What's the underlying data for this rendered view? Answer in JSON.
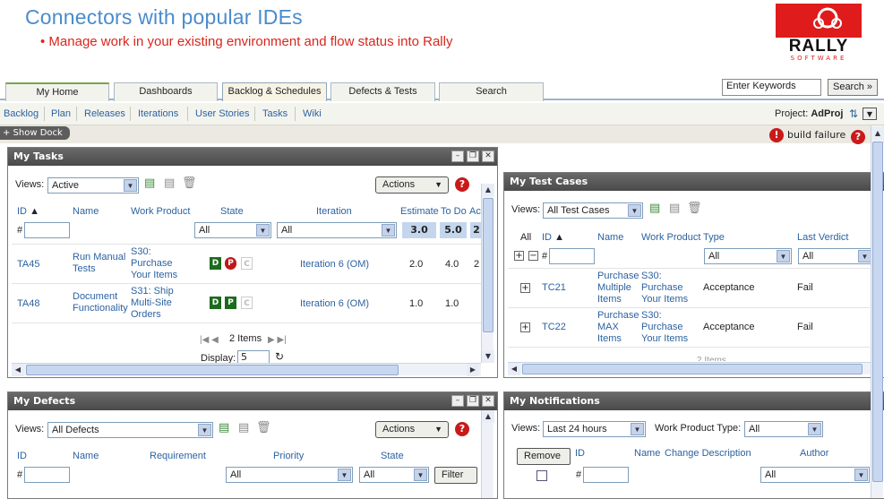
{
  "header": {
    "title": "Connectors with popular IDEs",
    "subtitle": "• Manage work in your existing environment and flow status into Rally",
    "logo_word": "RALLY",
    "logo_sub": "SOFTWARE"
  },
  "tabs": [
    "My Home",
    "Dashboards",
    "Backlog & Schedules",
    "Defects & Tests",
    "Search"
  ],
  "search": {
    "value": "Enter Keywords",
    "button": "Search »"
  },
  "subnav": [
    "Backlog",
    "Plan",
    "Releases",
    "Iterations",
    "User Stories",
    "Tasks",
    "Wiki"
  ],
  "project": {
    "label": "Project:",
    "name": "AdProj"
  },
  "dock": {
    "show": "+ Show Dock",
    "alert": "build failure"
  },
  "tasks": {
    "title": "My Tasks",
    "views_label": "Views:",
    "view": "Active",
    "actions": "Actions",
    "columns": [
      "ID",
      "Name",
      "Work Product",
      "State",
      "Iteration",
      "Estimate",
      "To Do",
      "Ac"
    ],
    "filter_state": "All",
    "filter_iteration": "All",
    "totals": {
      "estimate": "3.0",
      "todo": "5.0",
      "actual": "2"
    },
    "rows": [
      {
        "id": "TA45",
        "name": "Run Manual Tests",
        "wp": "S30: Purchase Your Items",
        "iteration": "Iteration 6 (OM)",
        "estimate": "2.0",
        "todo": "4.0",
        "actual": "2"
      },
      {
        "id": "TA48",
        "name": "Document Functionality",
        "wp": "S31: Ship Multi-Site Orders",
        "iteration": "Iteration 6 (OM)",
        "estimate": "1.0",
        "todo": "1.0",
        "actual": ""
      }
    ],
    "pager": "2 Items",
    "display_label": "Display:",
    "display_value": "5"
  },
  "testcases": {
    "title": "My Test Cases",
    "views_label": "Views:",
    "view": "All Test Cases",
    "columns": [
      "All",
      "ID",
      "Name",
      "Work Product",
      "Type",
      "Last Verdict"
    ],
    "filter_type": "All",
    "filter_verdict": "All",
    "rows": [
      {
        "id": "TC21",
        "name": "Purchase Multiple Items",
        "wp": "S30: Purchase Your Items",
        "type": "Acceptance",
        "verdict": "Fail"
      },
      {
        "id": "TC22",
        "name": "Purchase MAX Items",
        "wp": "S30: Purchase Your Items",
        "type": "Acceptance",
        "verdict": "Fail"
      }
    ],
    "pager": "2 Items"
  },
  "defects": {
    "title": "My Defects",
    "views_label": "Views:",
    "view": "All Defects",
    "actions": "Actions",
    "columns": [
      "ID",
      "Name",
      "Requirement",
      "Priority",
      "State"
    ],
    "filter_priority": "All",
    "filter_state": "All",
    "filter_button": "Filter"
  },
  "notifications": {
    "title": "My Notifications",
    "views_label": "Views:",
    "view": "Last 24 hours",
    "wpt_label": "Work Product Type:",
    "wpt_value": "All",
    "remove": "Remove",
    "columns": [
      "ID",
      "Name",
      "Change Description",
      "Author"
    ],
    "filter_author": "All"
  }
}
